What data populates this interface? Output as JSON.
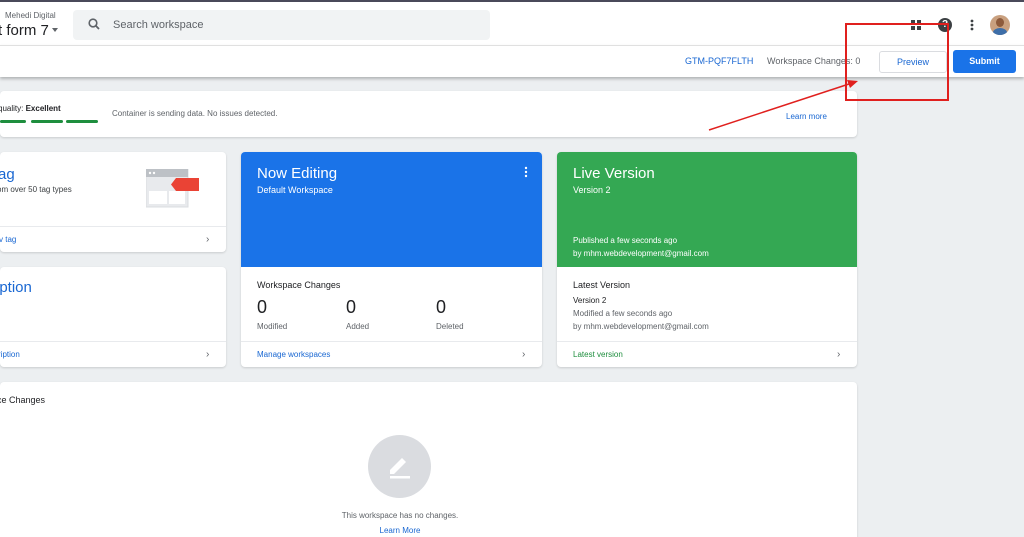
{
  "header": {
    "account_name": "Mehedi Digital",
    "container_name": "t form 7",
    "search_placeholder": "Search workspace",
    "help_glyph": "?",
    "icons": [
      "apps-icon",
      "help-icon",
      "more-vert-icon",
      "avatar"
    ]
  },
  "toolbar": {
    "container_id": "GTM-PQF7FLTH",
    "workspace_changes": "Workspace Changes: 0",
    "preview_label": "Preview",
    "submit_label": "Submit"
  },
  "quality": {
    "label_prefix": "quality:",
    "label_value": "Excellent",
    "bars": 4,
    "message": "Container is sending data. No issues detected.",
    "learn_more": "Learn more",
    "color": "#1e8e3e"
  },
  "new_tag": {
    "title": "ag",
    "subtitle": "om over 50 tag types",
    "link": "v tag"
  },
  "description": {
    "title": "iption",
    "link": "ription"
  },
  "now_editing": {
    "title": "Now Editing",
    "workspace": "Default Workspace",
    "changes_label": "Workspace Changes",
    "stats": [
      {
        "value": "0",
        "label": "Modified"
      },
      {
        "value": "0",
        "label": "Added"
      },
      {
        "value": "0",
        "label": "Deleted"
      }
    ],
    "link": "Manage workspaces",
    "color": "#1a73e8"
  },
  "live_version": {
    "title": "Live Version",
    "version": "Version 2",
    "published": "Published a few seconds ago",
    "published_by": "by mhm.webdevelopment@gmail.com",
    "latest_label": "Latest Version",
    "latest_version": "Version 2",
    "modified": "Modified a few seconds ago",
    "modified_by": "by mhm.webdevelopment@gmail.com",
    "link": "Latest version",
    "color": "#34a853"
  },
  "workspace_changes_card": {
    "title": "ce Changes",
    "empty_message": "This workspace has no changes.",
    "learn_more": "Learn More"
  },
  "annotation_color": "#e0201e"
}
